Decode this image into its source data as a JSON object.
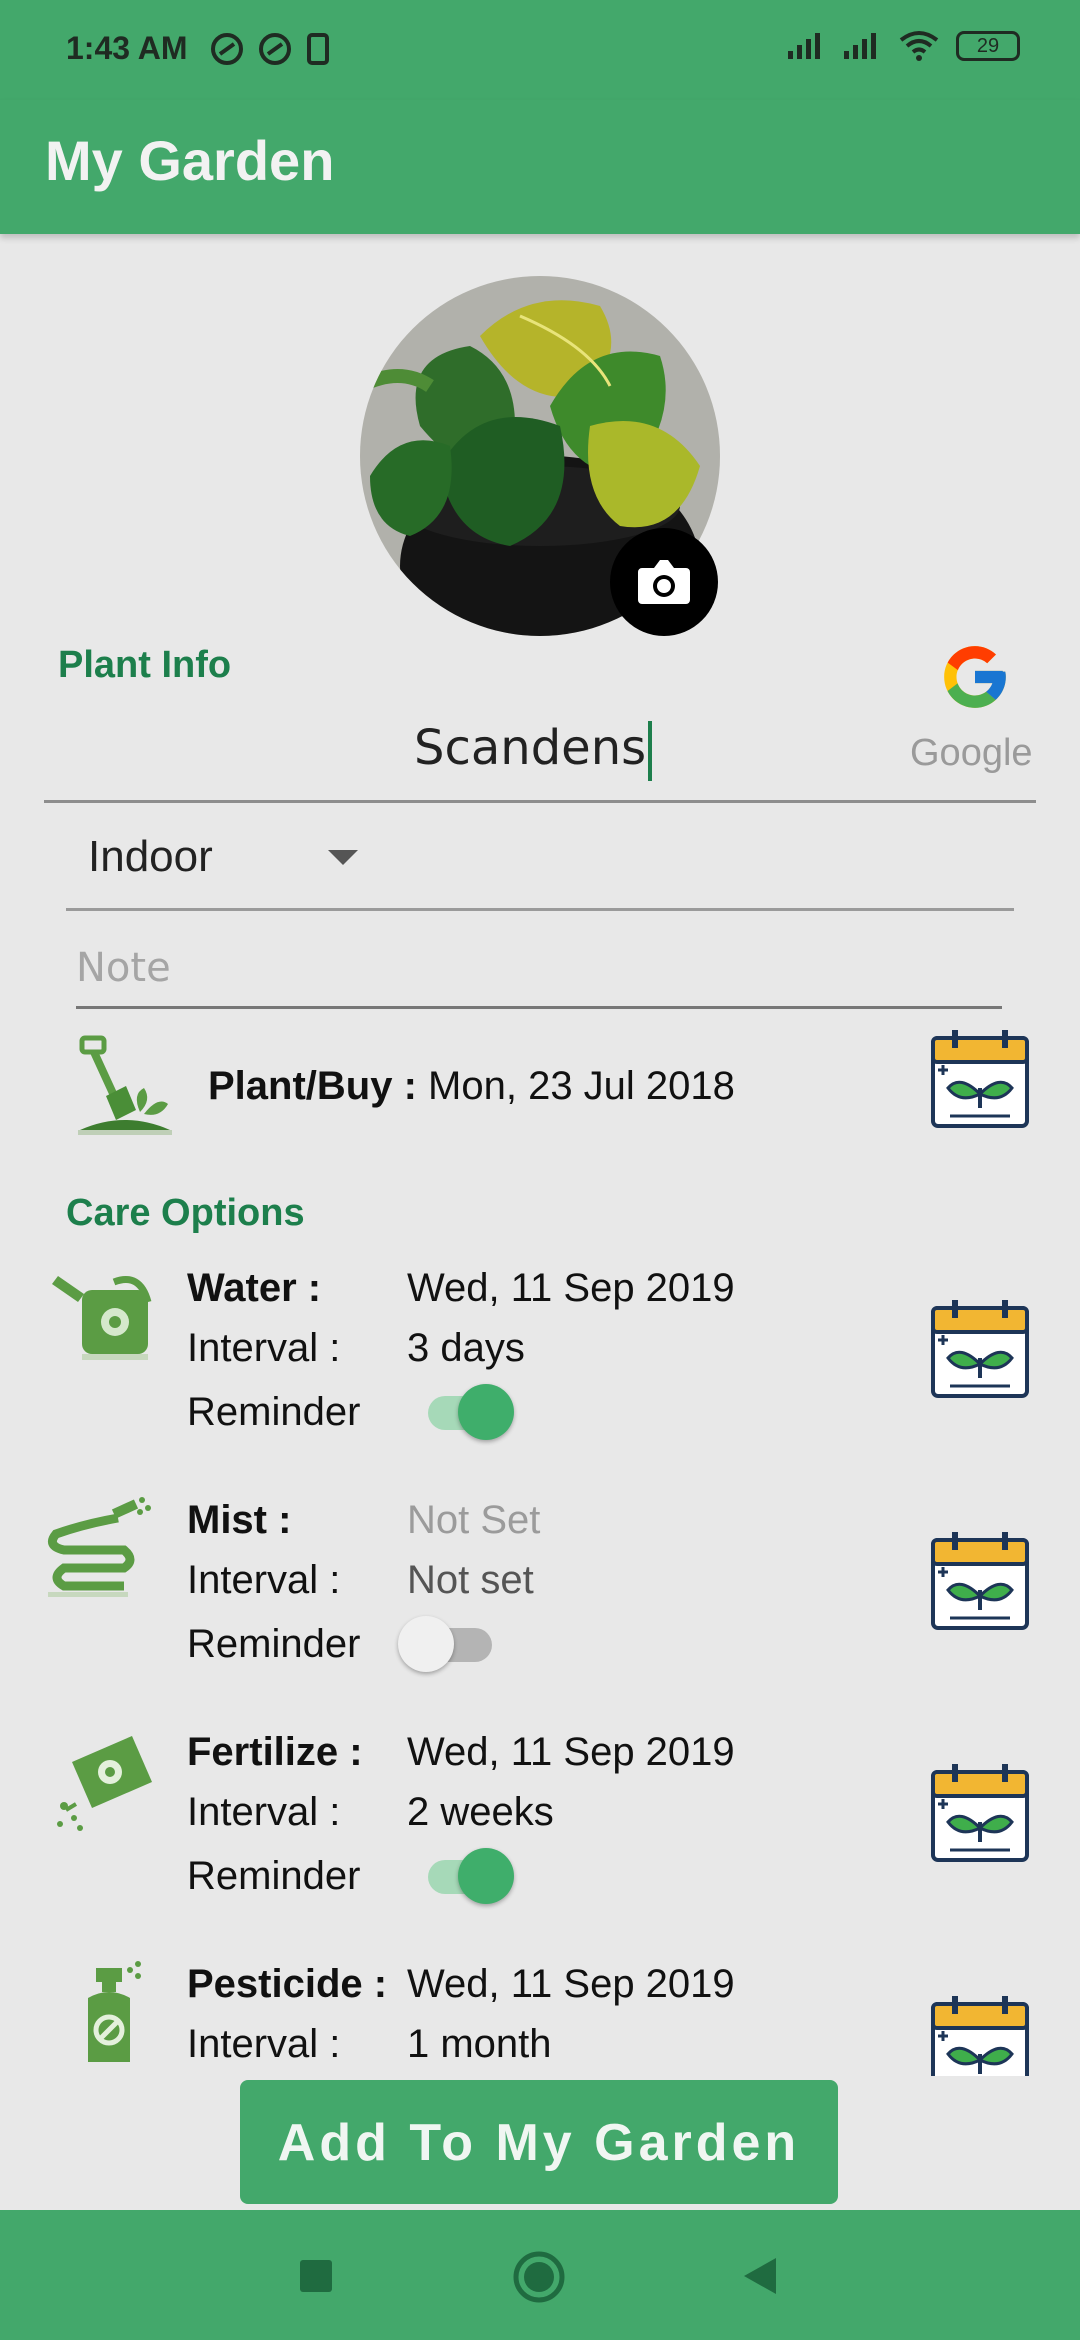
{
  "status_bar": {
    "time": "1:43 AM",
    "battery": "29"
  },
  "app_bar": {
    "title": "My Garden"
  },
  "plant_info": {
    "section_title": "Plant Info",
    "name_value": "Scandens",
    "google_label": "Google",
    "location_selected": "Indoor",
    "note_placeholder": "Note",
    "plant_buy_label": "Plant/Buy :",
    "plant_buy_date": "Mon, 23 Jul 2018"
  },
  "care": {
    "section_title": "Care Options",
    "items": [
      {
        "name": "Water :",
        "date": "Wed, 11 Sep 2019",
        "interval_label": "Interval :",
        "interval": "3 days",
        "reminder_label": "Reminder",
        "reminder_on": true
      },
      {
        "name": "Mist :",
        "date": "Not Set",
        "interval_label": "Interval :",
        "interval": "Not set",
        "reminder_label": "Reminder",
        "reminder_on": false
      },
      {
        "name": "Fertilize :",
        "date": "Wed, 11 Sep 2019",
        "interval_label": "Interval :",
        "interval": "2 weeks",
        "reminder_label": "Reminder",
        "reminder_on": true
      },
      {
        "name": "Pesticide :",
        "date": "Wed, 11 Sep 2019",
        "interval_label": "Interval :",
        "interval": "1 month"
      }
    ]
  },
  "add_button": {
    "label": "Add To My Garden"
  },
  "colors": {
    "primary": "#43a86b",
    "accent_text": "#1d7f4c",
    "background": "#e8e8e8"
  },
  "icons": {
    "camera": "camera-icon",
    "google": "google-logo",
    "calendar": "calendar-plant-icon",
    "shovel": "shovel-plant-icon",
    "water": "watering-can-icon",
    "mist": "hose-icon",
    "fertilize": "fertilizer-bag-icon",
    "pesticide": "spray-bottle-icon"
  }
}
